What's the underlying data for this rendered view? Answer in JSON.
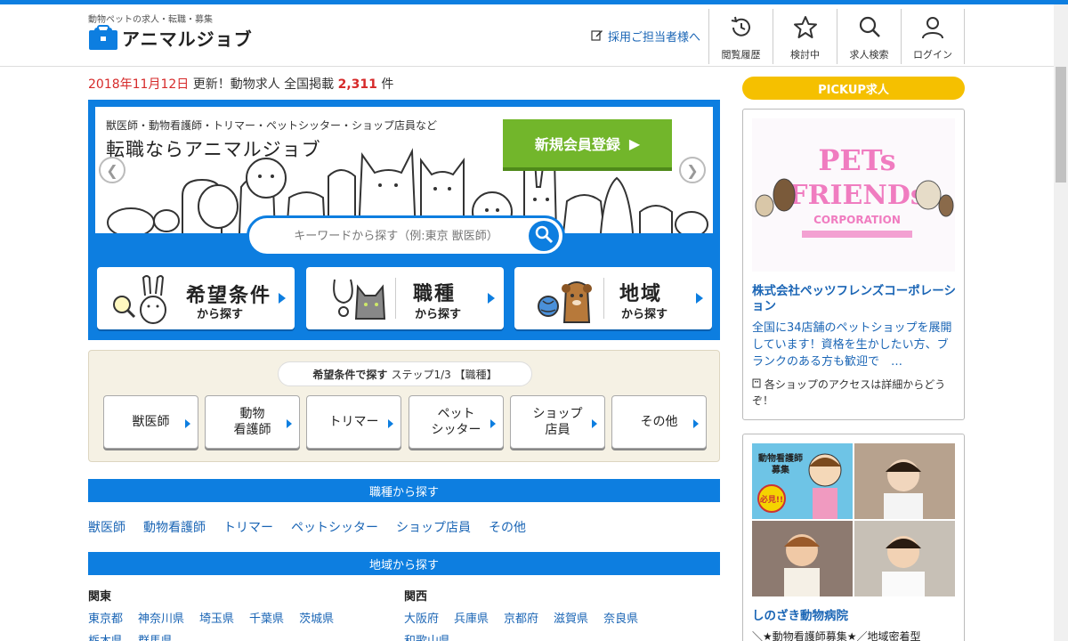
{
  "header": {
    "tagline": "動物ペットの求人・転職・募集",
    "logo_text": "アニマルジョブ",
    "recruit_link": "採用ご担当者様へ",
    "nav": [
      {
        "label": "閲覧履歴",
        "icon": "history-icon"
      },
      {
        "label": "検討中",
        "icon": "star-icon"
      },
      {
        "label": "求人検索",
        "icon": "search-icon"
      },
      {
        "label": "ログイン",
        "icon": "user-icon"
      }
    ]
  },
  "update": {
    "date": "2018年11月12日",
    "text1": "更新！動物求人 全国掲載",
    "count": "2,311",
    "unit": "件"
  },
  "hero": {
    "subtitle": "獣医師・動物看護師・トリマー・ペットシッター・ショップ店員など",
    "title": "転職ならアニマルジョブ",
    "register_label": "新規会員登録",
    "search_placeholder": "キーワードから探す（例:東京 獣医師）",
    "cards": [
      {
        "big": "希望条件",
        "small": "から探す",
        "icon": "rabbit-magnifier-icon"
      },
      {
        "big": "職種",
        "small": "から探す",
        "icon": "cat-stethoscope-icon"
      },
      {
        "big": "地域",
        "small": "から探す",
        "icon": "dog-globe-icon"
      }
    ]
  },
  "step": {
    "label_bold": "希望条件で探す",
    "label_rest": "ステップ1/3 【職種】",
    "buttons": [
      {
        "line1": "獣医師",
        "line2": ""
      },
      {
        "line1": "動物",
        "line2": "看護師"
      },
      {
        "line1": "トリマー",
        "line2": ""
      },
      {
        "line1": "ペット",
        "line2": "シッター"
      },
      {
        "line1": "ショップ",
        "line2": "店員"
      },
      {
        "line1": "その他",
        "line2": ""
      }
    ]
  },
  "job_section": {
    "title": "職種から探す",
    "links": [
      "獣医師",
      "動物看護師",
      "トリマー",
      "ペットシッター",
      "ショップ店員",
      "その他"
    ]
  },
  "region_section": {
    "title": "地域から探す",
    "kanto": {
      "name": "関東",
      "row1": [
        "東京都",
        "神奈川県",
        "埼玉県",
        "千葉県",
        "茨城県"
      ],
      "row2": [
        "栃木県",
        "群馬県"
      ]
    },
    "kansai": {
      "name": "関西",
      "row1": [
        "大阪府",
        "兵庫県",
        "京都府",
        "滋賀県",
        "奈良県"
      ],
      "row2": [
        "和歌山県"
      ]
    }
  },
  "pickup": {
    "title": "PICKUP求人",
    "card1": {
      "logo_line1": "PETs",
      "logo_line2": "FRIENDs",
      "logo_line3": "CORPORATION",
      "company": "株式会社ペッツフレンズコーポレーション",
      "desc": "全国に34店舗のペットショップを展開しています！資格を生かしたい方、ブランクのある方も歓迎で　…",
      "note": "各ショップのアクセスは詳細からどうぞ！"
    },
    "card2": {
      "badge_line1": "動物看護師",
      "badge_line2": "募集",
      "badge_line3": "必見!!",
      "company": "しのざき動物病院",
      "desc": "＼★動物看護師募集★／地域密着型"
    }
  },
  "colors": {
    "brand_blue": "#0d7ee0",
    "accent_red": "#d62a2a",
    "green": "#72b62b",
    "yellow": "#f5c000"
  }
}
